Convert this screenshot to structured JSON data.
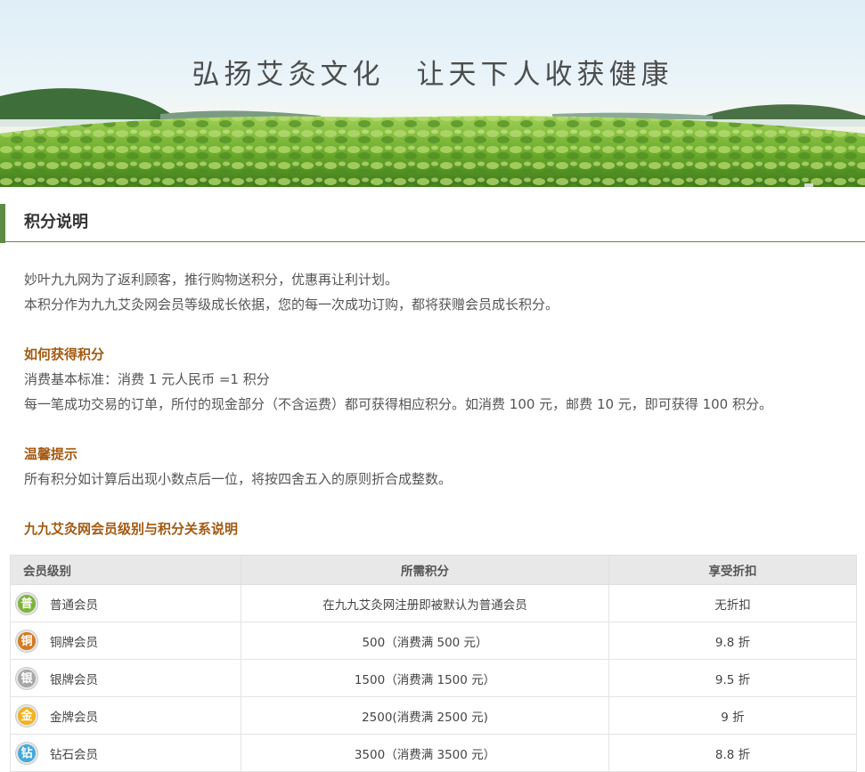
{
  "banner": {
    "title": "弘扬艾灸文化　让天下人收获健康"
  },
  "section": {
    "title": "积分说明"
  },
  "intro": {
    "line1": "妙叶九九网为了返利顾客，推行购物送积分，优惠再让利计划。",
    "line2": "本积分作为九九艾灸网会员等级成长依据，您的每一次成功订购，都将获赠会员成长积分。"
  },
  "how": {
    "heading": "如何获得积分",
    "line1": "消费基本标准：消费 1 元人民币 =1 积分",
    "line2": "每一笔成功交易的订单，所付的现金部分（不含运费）都可获得相应积分。如消费 100 元，邮费 10 元，即可获得 100 积分。"
  },
  "tips": {
    "heading": "温馨提示",
    "line1": "所有积分如计算后出现小数点后一位，将按四舍五入的原则折合成整数。"
  },
  "relation": {
    "heading": "九九艾灸网会员级别与积分关系说明"
  },
  "table": {
    "headers": {
      "level": "会员级别",
      "points": "所需积分",
      "discount": "享受折扣"
    },
    "rows": [
      {
        "badge": "普",
        "badge_color": "#7fb33a",
        "level": "普通会员",
        "points": "在九九艾灸网注册即被默认为普通会员",
        "discount": "无折扣"
      },
      {
        "badge": "铜",
        "badge_color": "#d37a1f",
        "level": "铜牌会员",
        "points": "500（消费满 500 元）",
        "discount": "9.8 折"
      },
      {
        "badge": "银",
        "badge_color": "#a7a7a7",
        "level": "银牌会员",
        "points": "1500（消费满 1500 元）",
        "discount": "9.5 折"
      },
      {
        "badge": "金",
        "badge_color": "#f2b21c",
        "level": "金牌会员",
        "points": "2500(消费满 2500 元)",
        "discount": "9 折"
      },
      {
        "badge": "钻",
        "badge_color": "#45a9d8",
        "level": "钻石会员",
        "points": "3500（消费满 3500 元）",
        "discount": "8.8 折"
      }
    ]
  }
}
